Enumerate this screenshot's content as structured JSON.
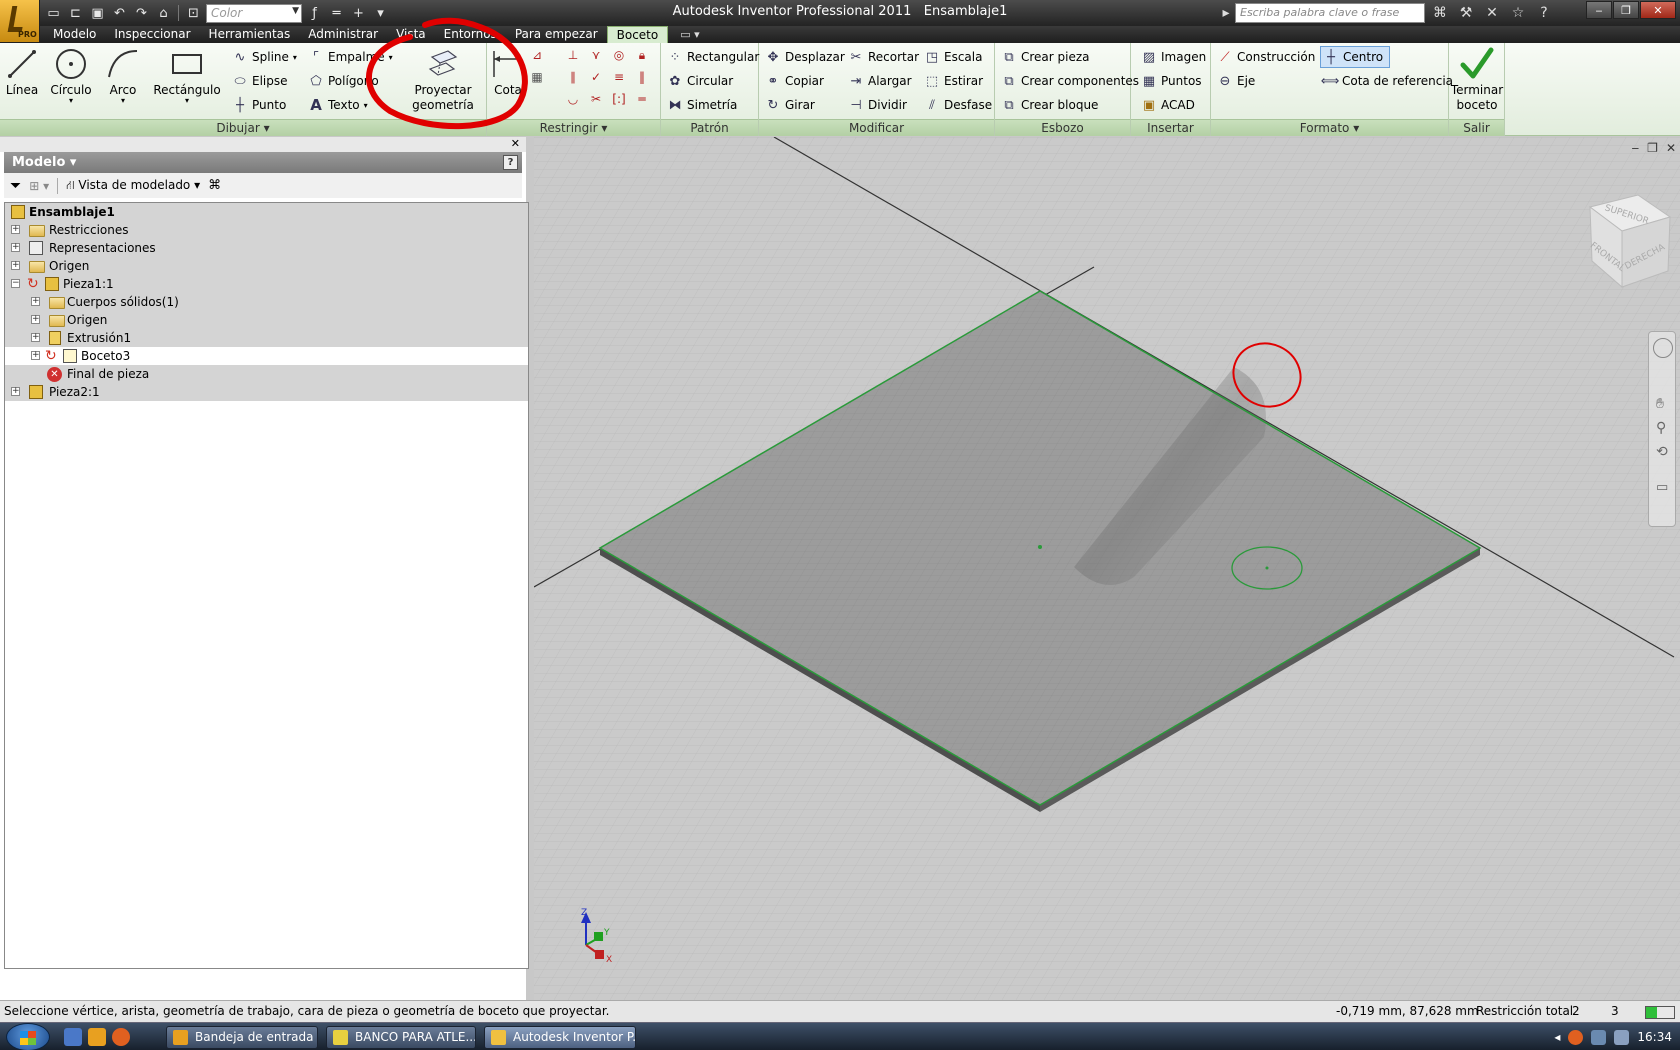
{
  "window": {
    "title": "Autodesk Inventor Professional 2011",
    "document": "Ensamblaje1",
    "logo_text": "PRO",
    "color_placeholder": "Color",
    "search_placeholder": "Escriba palabra clave o frase"
  },
  "tabs": [
    {
      "label": "Modelo"
    },
    {
      "label": "Inspeccionar"
    },
    {
      "label": "Herramientas"
    },
    {
      "label": "Administrar"
    },
    {
      "label": "Vista"
    },
    {
      "label": "Entornos"
    },
    {
      "label": "Para empezar"
    },
    {
      "label": "Boceto",
      "active": true
    }
  ],
  "ribbon": {
    "dibujar": {
      "label": "Dibujar",
      "linea": "Línea",
      "circulo": "Círculo",
      "arco": "Arco",
      "rectangulo": "Rectángulo",
      "spline": "Spline",
      "elipse": "Elipse",
      "punto": "Punto",
      "empalme": "Empalme",
      "poligono": "Polígono",
      "texto": "Texto",
      "proyectar_1": "Proyectar",
      "proyectar_2": "geometría"
    },
    "restringir": {
      "label": "Restringir",
      "cota": "Cota"
    },
    "patron": {
      "label": "Patrón",
      "rectangular": "Rectangular",
      "circular": "Circular",
      "simetria": "Simetría"
    },
    "modificar": {
      "label": "Modificar",
      "desplazar": "Desplazar",
      "copiar": "Copiar",
      "girar": "Girar",
      "recortar": "Recortar",
      "alargar": "Alargar",
      "dividir": "Dividir",
      "escala": "Escala",
      "estirar": "Estirar",
      "desfase": "Desfase"
    },
    "esbozo": {
      "label": "Esbozo",
      "crear_pieza": "Crear pieza",
      "crear_componentes": "Crear componentes",
      "crear_bloque": "Crear bloque"
    },
    "insertar": {
      "label": "Insertar",
      "imagen": "Imagen",
      "puntos": "Puntos",
      "acad": "ACAD"
    },
    "formato": {
      "label": "Formato",
      "construccion": "Construcción",
      "eje": "Eje",
      "centro": "Centro",
      "cota_referencia": "Cota de referencia"
    },
    "salir": {
      "label": "Salir",
      "terminar_1": "Terminar",
      "terminar_2": "boceto"
    }
  },
  "browser": {
    "title": "Modelo",
    "help": "?",
    "view_mode": "Vista de modelado",
    "tree": [
      {
        "label": "Ensamblaje1",
        "bold": true
      },
      {
        "label": "Restricciones"
      },
      {
        "label": "Representaciones"
      },
      {
        "label": "Origen"
      },
      {
        "label": "Pieza1:1"
      },
      {
        "label": "Cuerpos sólidos(1)"
      },
      {
        "label": "Origen"
      },
      {
        "label": "Extrusión1"
      },
      {
        "label": "Boceto3"
      },
      {
        "label": "Final de pieza"
      },
      {
        "label": "Pieza2:1"
      }
    ]
  },
  "viewcube": {
    "top": "SUPERIOR",
    "front": "FRONTAL",
    "right": "DERECHA"
  },
  "triad": {
    "z": "Z",
    "y": "Y",
    "x": "X"
  },
  "status": {
    "message": "Seleccione vértice, arista, geometría de trabajo, cara de pieza o geometría de boceto que proyectar.",
    "coords": "-0,719 mm, 87,628 mm",
    "restriccion": "Restricción total",
    "n1": "2",
    "n2": "3"
  },
  "taskbar": {
    "items": [
      {
        "label": "Bandeja de entrada ..."
      },
      {
        "label": "BANCO PARA ATLE..."
      },
      {
        "label": "Autodesk Inventor P..."
      }
    ],
    "clock": "16:34"
  },
  "colors": {
    "ribbon_green": "#d8ecd0",
    "sketch_edge": "#2a9a3a",
    "annotation_red": "#e00000"
  }
}
